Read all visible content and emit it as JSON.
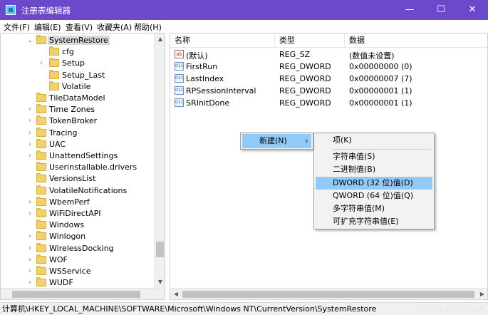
{
  "window": {
    "title": "注册表编辑器",
    "minimize": "—",
    "maximize": "☐",
    "close": "✕"
  },
  "menubar": [
    "文件(F)",
    "编辑(E)",
    "查看(V)",
    "收藏夹(A)",
    "帮助(H)"
  ],
  "tree": {
    "items": [
      {
        "label": "SystemRestore",
        "expander": "⌄",
        "selected": true
      },
      {
        "label": "cfg",
        "expander": ""
      },
      {
        "label": "Setup",
        "expander": "›"
      },
      {
        "label": "Setup_Last",
        "expander": ""
      },
      {
        "label": "Volatile",
        "expander": ""
      },
      {
        "label": "TileDataModel",
        "expander": ""
      },
      {
        "label": "Time Zones",
        "expander": "›"
      },
      {
        "label": "TokenBroker",
        "expander": "›"
      },
      {
        "label": "Tracing",
        "expander": "›"
      },
      {
        "label": "UAC",
        "expander": "›"
      },
      {
        "label": "UnattendSettings",
        "expander": "›"
      },
      {
        "label": "Userinstallable.drivers",
        "expander": ""
      },
      {
        "label": "VersionsList",
        "expander": ""
      },
      {
        "label": "VolatileNotifications",
        "expander": ""
      },
      {
        "label": "WbemPerf",
        "expander": "›"
      },
      {
        "label": "WiFiDirectAPI",
        "expander": "›"
      },
      {
        "label": "Windows",
        "expander": ""
      },
      {
        "label": "Winlogon",
        "expander": "›"
      },
      {
        "label": "WirelessDocking",
        "expander": "›"
      },
      {
        "label": "WOF",
        "expander": "›"
      },
      {
        "label": "WSService",
        "expander": "›"
      },
      {
        "label": "WUDF",
        "expander": "›"
      }
    ]
  },
  "values": {
    "columns": [
      "名称",
      "类型",
      "数据"
    ],
    "rows": [
      {
        "icon": "ab",
        "name": "(默认)",
        "type": "REG_SZ",
        "data": "(数值未设置)"
      },
      {
        "icon": "011",
        "name": "FirstRun",
        "type": "REG_DWORD",
        "data": "0x00000000 (0)"
      },
      {
        "icon": "011",
        "name": "LastIndex",
        "type": "REG_DWORD",
        "data": "0x00000007 (7)"
      },
      {
        "icon": "011",
        "name": "RPSessionInterval",
        "type": "REG_DWORD",
        "data": "0x00000001 (1)"
      },
      {
        "icon": "011",
        "name": "SRInitDone",
        "type": "REG_DWORD",
        "data": "0x00000001 (1)"
      }
    ]
  },
  "context_menu": {
    "new_label": "新建(N)",
    "arrow": "›"
  },
  "submenu": {
    "items": [
      "项(K)",
      "字符串值(S)",
      "二进制值(B)",
      "DWORD (32 位)值(D)",
      "QWORD (64 位)值(Q)",
      "多字符串值(M)",
      "可扩充字符串值(E)"
    ],
    "highlighted_index": 3
  },
  "statusbar": {
    "path": "计算机\\HKEY_LOCAL_MACHINE\\SOFTWARE\\Microsoft\\Windows NT\\CurrentVersion\\SystemRestore"
  },
  "watermark": "cfan.com.cn",
  "colors": {
    "titlebar": "#6b49c8",
    "highlight": "#91c9f7",
    "selected": "#d9d9d9"
  },
  "icons": {
    "folder": "folder-icon",
    "string_value": "string-value-icon",
    "binary_value": "binary-value-icon"
  }
}
